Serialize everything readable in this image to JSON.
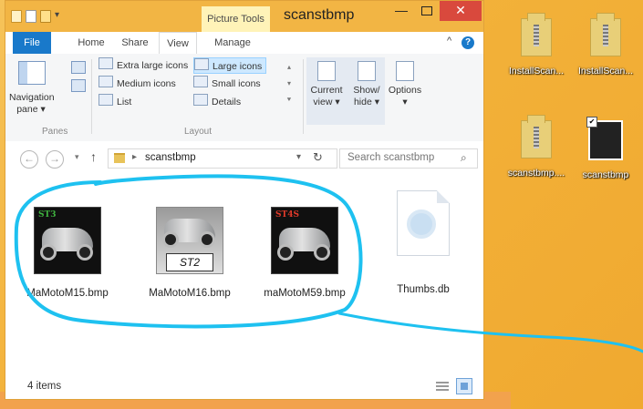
{
  "window": {
    "title": "scanstbmp",
    "context_tab": "Picture Tools",
    "controls": {
      "minimize": "—",
      "maximize": "",
      "close": "✕"
    }
  },
  "tabs": [
    {
      "label": "File"
    },
    {
      "label": "Home"
    },
    {
      "label": "Share"
    },
    {
      "label": "View"
    },
    {
      "label": "Manage"
    }
  ],
  "ribbon": {
    "panes": {
      "navigation_pane": "Navigation pane",
      "group": "Panes"
    },
    "layout": {
      "group": "Layout",
      "items": [
        {
          "label": "Extra large icons",
          "selected": false
        },
        {
          "label": "Large icons",
          "selected": true
        },
        {
          "label": "Medium icons",
          "selected": false
        },
        {
          "label": "Small icons",
          "selected": false
        },
        {
          "label": "List",
          "selected": false
        },
        {
          "label": "Details",
          "selected": false
        }
      ]
    },
    "current_view": "Current view",
    "show_hide": "Show/ hide",
    "options": "Options"
  },
  "address": {
    "path": "scanstbmp",
    "search_placeholder": "Search scanstbmp"
  },
  "files": [
    {
      "name": "MaMotoM15.bmp",
      "badge": "ST3",
      "kind": "moto"
    },
    {
      "name": "MaMotoM16.bmp",
      "badge": "ST2",
      "kind": "st2"
    },
    {
      "name": "maMotoM59.bmp",
      "badge": "ST4S",
      "kind": "moto"
    },
    {
      "name": "Thumbs.db",
      "kind": "db"
    }
  ],
  "status": {
    "items": "4 items"
  },
  "desktop_icons": [
    {
      "label": "InstallScan..."
    },
    {
      "label": "InstallScan..."
    },
    {
      "label": "scanstbmp...."
    },
    {
      "label": "scanstbmp"
    }
  ],
  "colors": {
    "title_bar": "#f2b544",
    "file_tab": "#1979ca",
    "close_button": "#d9493d",
    "annotation": "#1ec1f0",
    "desktop": "#f3b23a"
  }
}
